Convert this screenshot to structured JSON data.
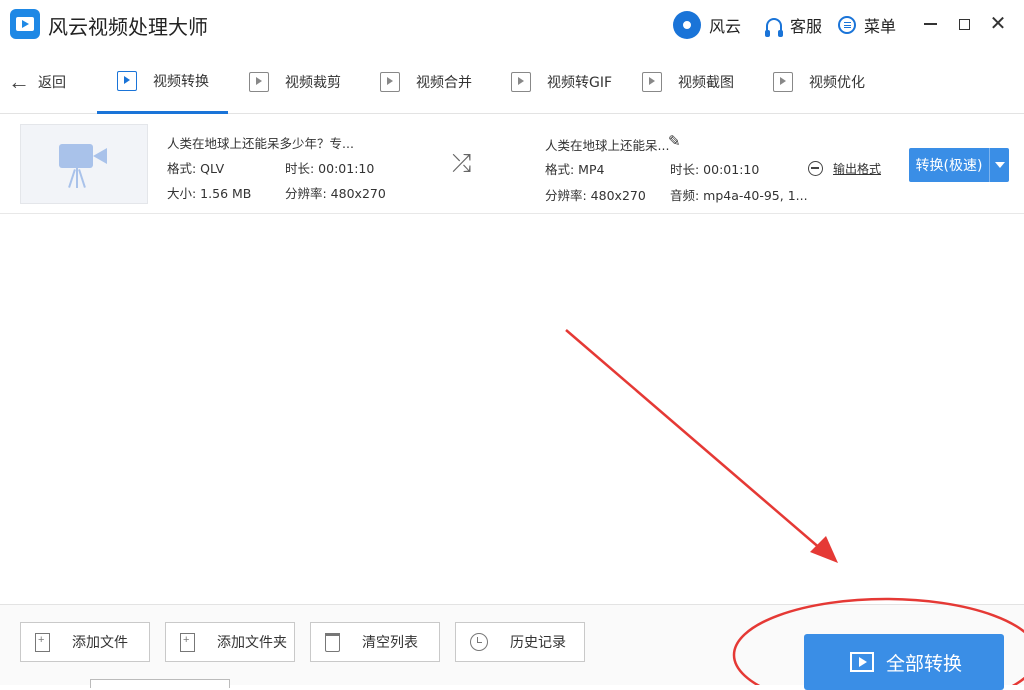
{
  "app": {
    "title": "风云视频处理大师"
  },
  "titlebar": {
    "account_label": "风云",
    "service_label": "客服",
    "menu_label": "菜单"
  },
  "nav": {
    "back_label": "返回",
    "tabs": [
      {
        "label": "视频转换",
        "icon": "video-convert-icon",
        "active": true
      },
      {
        "label": "视频裁剪",
        "icon": "video-crop-icon",
        "active": false
      },
      {
        "label": "视频合并",
        "icon": "video-merge-icon",
        "active": false
      },
      {
        "label": "视频转GIF",
        "icon": "gif-icon",
        "active": false
      },
      {
        "label": "视频截图",
        "icon": "screenshot-icon",
        "active": false
      },
      {
        "label": "视频优化",
        "icon": "optimize-icon",
        "active": false
      }
    ]
  },
  "file": {
    "source": {
      "name": "人类在地球上还能呆多少年？专...",
      "format": "格式: QLV",
      "duration": "时长: 00:01:10",
      "size": "大小: 1.56 MB",
      "resolution": "分辨率: 480x270"
    },
    "output": {
      "name": "人类在地球上还能呆...",
      "format": "格式: MP4",
      "duration": "时长: 00:01:10",
      "resolution": "分辨率: 480x270",
      "audio": "音频: mp4a-40-95, 1..."
    },
    "output_format_label": "输出格式",
    "convert_label": "转换(极速)"
  },
  "actions": {
    "add_file": "添加文件",
    "add_folder": "添加文件夹",
    "clear_list": "清空列表",
    "history": "历史记录",
    "convert_all": "全部转换"
  },
  "colors": {
    "accent": "#3a8ee6",
    "annotation": "#e53935"
  }
}
